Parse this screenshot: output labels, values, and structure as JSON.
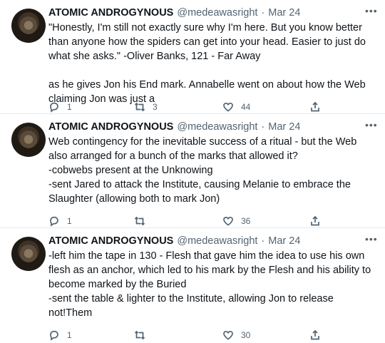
{
  "tweets": [
    {
      "name": "ATOMIC ANDROGYNOUS",
      "handle": "@medeawasright",
      "dot": "·",
      "date": "Mar 24",
      "text": "\"Honestly, I'm still not exactly sure why I'm here. But you know better than anyone how the spiders can get into your head. Easier to just do what she asks.\" -Oliver Banks, 121 - Far Away\n\nas he gives Jon his End mark. Annabelle went on about how the Web claiming Jon was just a",
      "replies": "1",
      "retweets": "3",
      "likes": "44"
    },
    {
      "name": "ATOMIC ANDROGYNOUS",
      "handle": "@medeawasright",
      "dot": "·",
      "date": "Mar 24",
      "text": "Web contingency for the inevitable success of a ritual - but the Web also arranged for a bunch of the marks that allowed it?\n-cobwebs present at the Unknowing\n-sent Jared to attack the Institute, causing Melanie to embrace the Slaughter (allowing both to mark Jon)",
      "replies": "1",
      "retweets": "",
      "likes": "36"
    },
    {
      "name": "ATOMIC ANDROGYNOUS",
      "handle": "@medeawasright",
      "dot": "·",
      "date": "Mar 24",
      "text": "-left him the tape in 130 - Flesh that gave him the idea to use his own flesh as an anchor, which led to his mark by the Flesh and his ability to become marked by the Buried\n-sent the table & lighter to the Institute, allowing Jon to release not!Them",
      "replies": "1",
      "retweets": "",
      "likes": "30"
    }
  ],
  "icons": {
    "more": "more-icon",
    "reply": "reply-icon",
    "retweet": "retweet-icon",
    "like": "heart-icon",
    "share": "share-icon"
  },
  "colors": {
    "text": "#0f1419",
    "muted": "#536471",
    "divider": "#e6ecf0"
  }
}
